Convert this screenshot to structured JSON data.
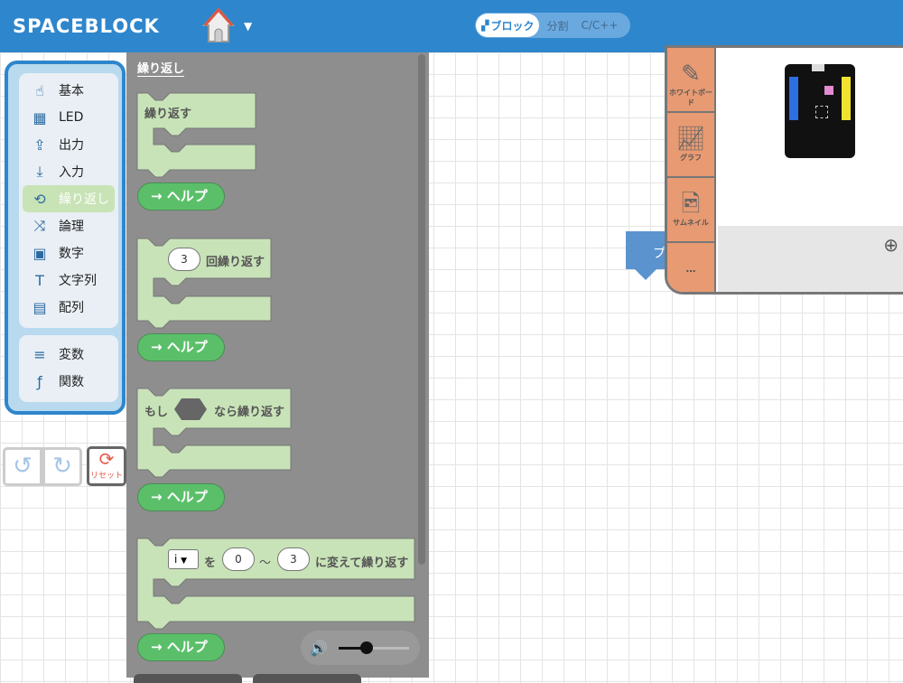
{
  "header": {
    "logo": "SPACEBLOCK",
    "modes": [
      "ブロック",
      "分割",
      "C/C++"
    ],
    "active_mode": "ブロック",
    "home_icon": "house-icon"
  },
  "categories": {
    "group1": [
      {
        "label": "基本",
        "icon": "hand-icon"
      },
      {
        "label": "LED",
        "icon": "led-icon"
      },
      {
        "label": "出力",
        "icon": "output-icon"
      },
      {
        "label": "入力",
        "icon": "input-icon"
      },
      {
        "label": "繰り返し",
        "icon": "loop-icon",
        "selected": true
      },
      {
        "label": "論理",
        "icon": "shuffle-icon"
      },
      {
        "label": "数字",
        "icon": "number-icon"
      },
      {
        "label": "文字列",
        "icon": "text-icon"
      },
      {
        "label": "配列",
        "icon": "list-icon"
      }
    ],
    "group2": [
      {
        "label": "変数",
        "icon": "variable-icon"
      },
      {
        "label": "関数",
        "icon": "function-icon"
      }
    ]
  },
  "history": {
    "reset_label": "リセット"
  },
  "palette": {
    "title": "繰り返し",
    "blocks": [
      {
        "text": "繰り返す"
      },
      {
        "count": "3",
        "text": "回繰り返す"
      },
      {
        "prefix": "もし",
        "text": "なら繰り返す"
      },
      {
        "var": "i",
        "wo": "を",
        "from": "0",
        "tilde": "～",
        "to": "3",
        "text": "に変えて繰り返す"
      }
    ],
    "help_label": "→ ヘルプ"
  },
  "volume": {
    "level": 0.4
  },
  "stage": {
    "buttons": [
      "ホワイトボード",
      "グラフ",
      "サムネイル",
      "…"
    ],
    "block_label": "プ",
    "colors": {
      "side": "#e89a72",
      "header": "#2e86cc"
    }
  }
}
